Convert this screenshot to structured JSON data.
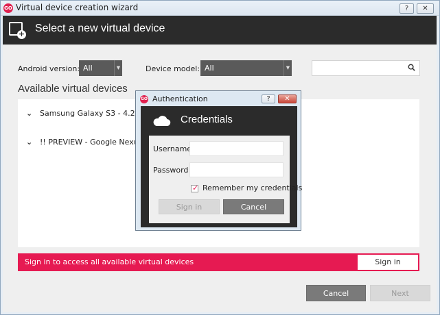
{
  "window": {
    "title": "Virtual device creation wizard",
    "app_icon_text": "GO",
    "help_label": "?",
    "close_label": "✕"
  },
  "header": {
    "title": "Select a new virtual device"
  },
  "filters": {
    "android_label": "Android version:",
    "android_value": "All",
    "model_label": "Device model:",
    "model_value": "All",
    "search_value": "",
    "search_icon": "search-icon"
  },
  "devices": {
    "title": "Available virtual devices",
    "items": [
      {
        "label": "Samsung Galaxy S3 - 4.2.2 - A"
      },
      {
        "label": "!! PREVIEW - Google Nexus 5"
      }
    ]
  },
  "signin_bar": {
    "text": "Sign in to access all available virtual devices",
    "button": "Sign in",
    "color": "#e61a52"
  },
  "footer": {
    "cancel": "Cancel",
    "next": "Next"
  },
  "auth_dialog": {
    "title": "Authentication",
    "app_icon_text": "GO",
    "help_label": "?",
    "close_label": "✕",
    "heading": "Credentials",
    "username_label": "Username",
    "username_value": "",
    "password_label": "Password",
    "password_value": "",
    "remember_label": "Remember my credentials",
    "remember_checked": true,
    "sign_in": "Sign in",
    "cancel": "Cancel"
  }
}
